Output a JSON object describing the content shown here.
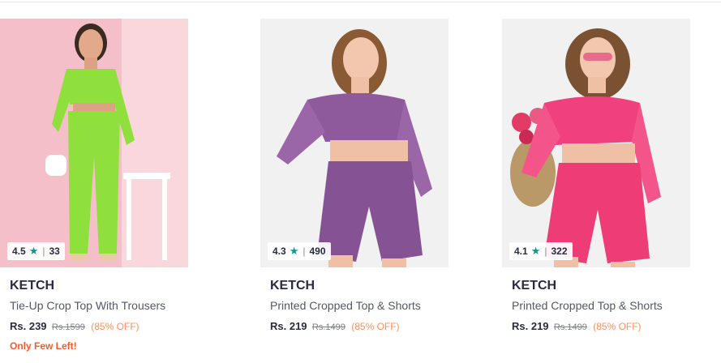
{
  "products": [
    {
      "brand": "KETCH",
      "name": "Printed Cropped Top & Shorts",
      "price": "Rs. 219",
      "mrp": "Rs.1499",
      "discount": "(85% OFF)",
      "rating": "4.3",
      "rating_count": "490",
      "stock_note": "",
      "outfit_color": "#8e5a9c",
      "bg_color": "#f1f1f2"
    },
    {
      "brand": "KETCH",
      "name": "Printed Cropped Top & Shorts",
      "price": "Rs. 219",
      "mrp": "Rs.1499",
      "discount": "(85% OFF)",
      "rating": "4.1",
      "rating_count": "322",
      "stock_note": "",
      "outfit_color": "#f0407e",
      "bg_color": "#f1f1f2"
    },
    {
      "brand": "KETCH",
      "name": "Tie-Up Crop Top With Trousers",
      "price": "Rs. 239",
      "mrp": "Rs.1599",
      "discount": "(85% OFF)",
      "rating": "4.5",
      "rating_count": "33",
      "stock_note": "Only Few Left!",
      "outfit_color": "#8fe03c",
      "bg_color": "#f7c9d2"
    }
  ],
  "icons": {
    "rating_star": "star-icon"
  },
  "colors": {
    "rating_star": "#14958f",
    "discount": "#ff905a",
    "stock_alert": "#ff5722"
  }
}
